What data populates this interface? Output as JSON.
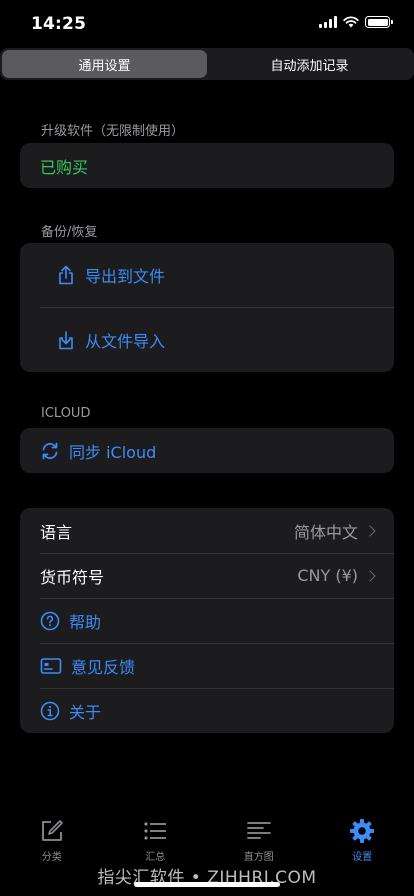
{
  "status": {
    "time": "14:25"
  },
  "segmented": {
    "general": "通用设置",
    "auto_add": "自动添加记录"
  },
  "upgrade": {
    "header": "升级软件（无限制使用）",
    "purchased": "已购买"
  },
  "backup": {
    "header": "备份/恢复",
    "export": "导出到文件",
    "import": "从文件导入"
  },
  "icloud": {
    "header": "ICLOUD",
    "sync": "同步 iCloud"
  },
  "settings": {
    "language_label": "语言",
    "language_value": "简体中文",
    "currency_label": "货币符号",
    "currency_value": "CNY (¥)",
    "help": "帮助",
    "feedback": "意见反馈",
    "about": "关于"
  },
  "tabbar": {
    "category": "分类",
    "summary": "汇总",
    "histogram": "直方图",
    "settings": "设置"
  },
  "watermark": "指尖汇软件 • ZJHHRJ.COM",
  "colors": {
    "accent": "#3b8cf6",
    "success": "#34c759",
    "background": "#000000",
    "card": "#1c1c1e"
  }
}
